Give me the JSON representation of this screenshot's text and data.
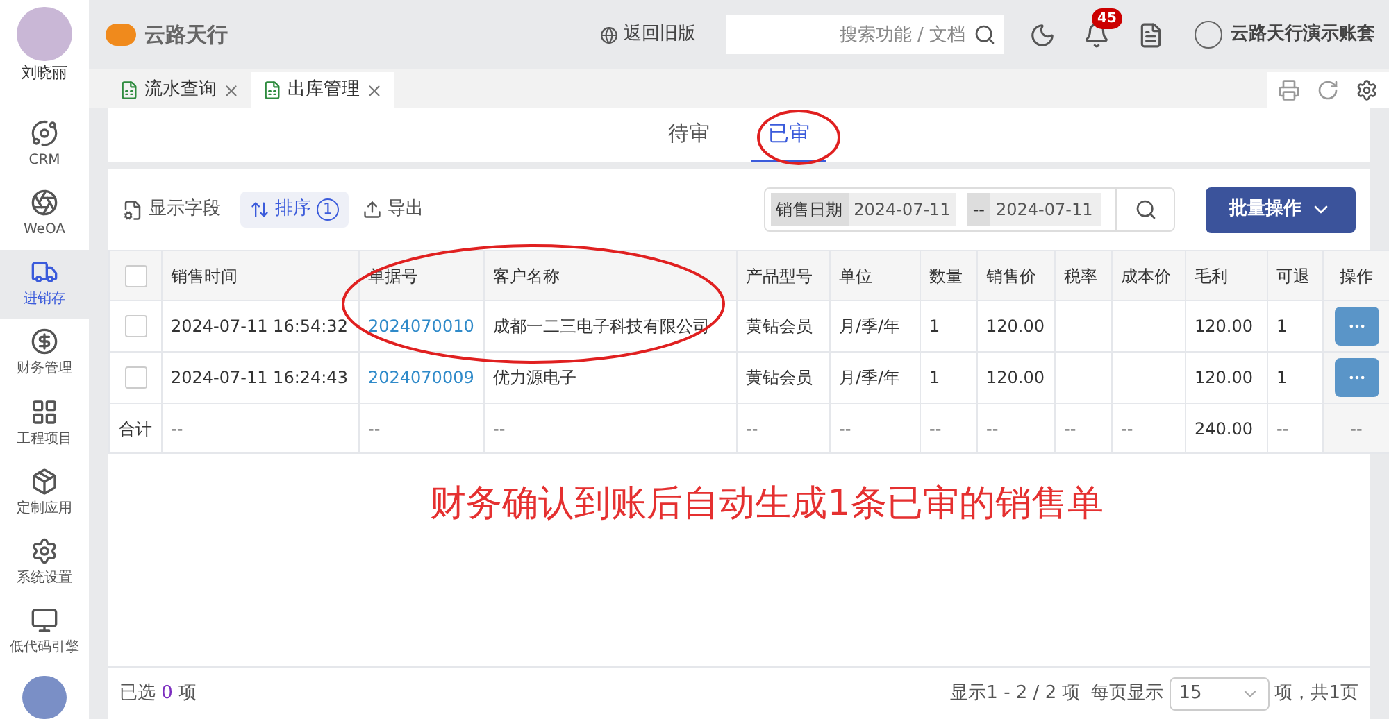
{
  "user": {
    "name": "刘晓丽"
  },
  "sidebar": {
    "items": [
      {
        "label": "CRM",
        "selected": false
      },
      {
        "label": "WeOA",
        "selected": false
      },
      {
        "label": "进销存",
        "selected": true
      },
      {
        "label": "财务管理",
        "selected": false
      },
      {
        "label": "工程项目",
        "selected": false
      },
      {
        "label": "定制应用",
        "selected": false
      },
      {
        "label": "系统设置",
        "selected": false
      },
      {
        "label": "低代码引擎",
        "selected": false
      }
    ]
  },
  "header": {
    "logo_text": "云路天行",
    "back_link": "返回旧版",
    "search": {
      "placeholder": "搜索功能 / 文档"
    },
    "notification_count": "45",
    "account": "云路天行演示账套"
  },
  "page_tabs": [
    {
      "label": "流水查询",
      "selected": false
    },
    {
      "label": "出库管理",
      "selected": true
    }
  ],
  "status_tabs": [
    {
      "label": "待审",
      "selected": false
    },
    {
      "label": "已审",
      "selected": true
    }
  ],
  "toolbar": {
    "fields_button": "显示字段",
    "sort_button": "排序",
    "sort_count": "1",
    "export_button": "导出",
    "date_filter": {
      "label": "销售日期",
      "from": "2024-07-11",
      "separator": "--",
      "to": "2024-07-11"
    },
    "batch_button": "批量操作"
  },
  "table": {
    "select_all_checked": false,
    "columns": [
      "销售时间",
      "单据号",
      "客户名称",
      "产品型号",
      "单位",
      "数量",
      "销售价",
      "税率",
      "成本价",
      "毛利",
      "可退",
      "操作"
    ],
    "rows": [
      {
        "checked": false,
        "cells": [
          "2024-07-11 16:54:32",
          "2024070010",
          "成都一二三电子科技有限公司",
          "黄钻会员",
          "月/季/年",
          "1",
          "120.00",
          "",
          "",
          "120.00",
          "1"
        ]
      },
      {
        "checked": false,
        "cells": [
          "2024-07-11 16:24:43",
          "2024070009",
          "优力源电子",
          "黄钻会员",
          "月/季/年",
          "1",
          "120.00",
          "",
          "",
          "120.00",
          "1"
        ]
      }
    ],
    "total": {
      "label": "合计",
      "cells": [
        "--",
        "--",
        "--",
        "--",
        "--",
        "--",
        "--",
        "--",
        "--",
        "240.00",
        "--",
        "--"
      ]
    }
  },
  "annotation": "财务确认到账后自动生成1条已审的销售单",
  "footer": {
    "selected_prefix": "已选",
    "selected_count": "0",
    "selected_suffix": "项",
    "range": "显示1 - 2 / 2 项",
    "per_page_label": "每页显示",
    "per_page": "15",
    "pages": "项，共1页"
  }
}
